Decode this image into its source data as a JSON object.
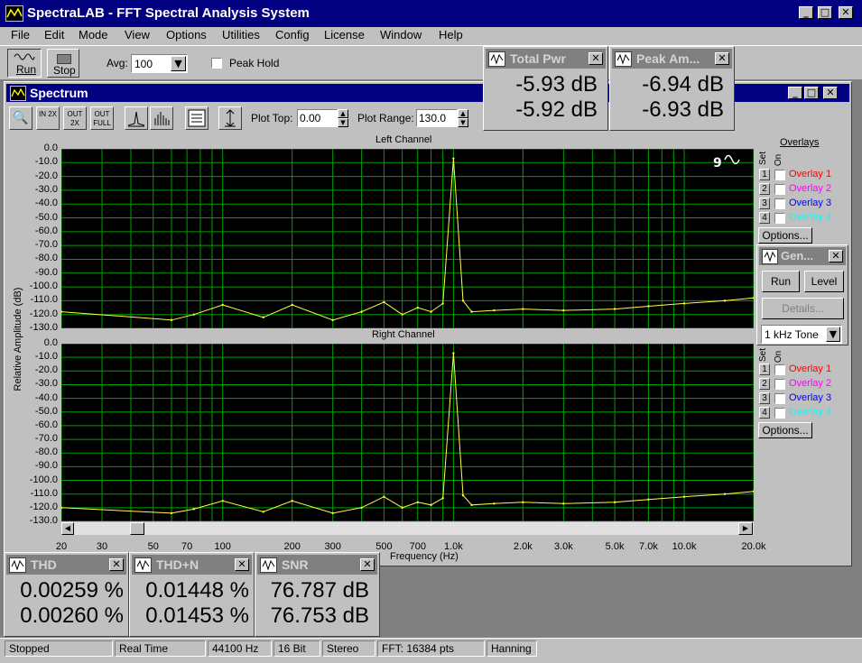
{
  "app": {
    "title": "SpectraLAB - FFT Spectral Analysis System"
  },
  "menu": [
    "File",
    "Edit",
    "Mode",
    "View",
    "Options",
    "Utilities",
    "Config",
    "License",
    "Window",
    "Help"
  ],
  "toolbar": {
    "run_label": "Run",
    "stop_label": "Stop",
    "avg_label": "Avg:",
    "avg_value": "100",
    "peak_hold_label": "Peak Hold"
  },
  "meters": {
    "total_pwr": {
      "title": "Total Pwr",
      "left": "-5.93 dB",
      "right": "-5.92 dB"
    },
    "peak_amp": {
      "title": "Peak Am...",
      "left": "-6.94 dB",
      "right": "-6.93 dB"
    },
    "thd": {
      "title": "THD",
      "left": "0.00259 %",
      "right": "0.00260 %"
    },
    "thdn": {
      "title": "THD+N",
      "left": "0.01448 %",
      "right": "0.01453 %"
    },
    "snr": {
      "title": "SNR",
      "left": "76.787 dB",
      "right": "76.753 dB"
    }
  },
  "spectrum": {
    "title": "Spectrum",
    "zoom_labels": [
      "IN 2X",
      "OUT 2X",
      "OUT FULL"
    ],
    "plot_top_label": "Plot Top:",
    "plot_top_value": "0.00",
    "plot_range_label": "Plot Range:",
    "plot_range_value": "130.0",
    "left_channel_label": "Left Channel",
    "right_channel_label": "Right Channel",
    "y_axis_label": "Relative Amplitude (dB)",
    "x_axis_label": "Frequency (Hz)",
    "y_ticks": [
      "0.0",
      "-10.0",
      "-20.0",
      "-30.0",
      "-40.0",
      "-50.0",
      "-60.0",
      "-70.0",
      "-80.0",
      "-90.0",
      "-100.0",
      "-110.0",
      "-120.0",
      "-130.0"
    ],
    "x_ticks": [
      "20",
      "30",
      "50",
      "70",
      "100",
      "200",
      "300",
      "500",
      "700",
      "1.0k",
      "2.0k",
      "3.0k",
      "5.0k",
      "7.0k",
      "10.0k",
      "20.0k"
    ]
  },
  "overlays": {
    "header": "Overlays",
    "set_label": "Set",
    "on_label": "On",
    "items": [
      {
        "num": "1",
        "label": "Overlay 1",
        "color": "#ff0000"
      },
      {
        "num": "2",
        "label": "Overlay 2",
        "color": "#ff00ff"
      },
      {
        "num": "3",
        "label": "Overlay 3",
        "color": "#0000ff"
      },
      {
        "num": "4",
        "label": "Overlay 4",
        "color": "#00ffff"
      }
    ],
    "options_label": "Options..."
  },
  "generator": {
    "title": "Gen...",
    "run_label": "Run",
    "level_label": "Level",
    "details_label": "Details...",
    "tone_value": "1 kHz Tone"
  },
  "status": [
    "Stopped",
    "Real Time",
    "44100 Hz",
    "16 Bit",
    "Stereo",
    "FFT: 16384 pts",
    "Hanning"
  ],
  "chart_data": {
    "type": "line",
    "title": "",
    "xlabel": "Frequency (Hz)",
    "ylabel": "Relative Amplitude (dB)",
    "xscale": "log",
    "xlim": [
      20,
      20000
    ],
    "ylim": [
      -130,
      0
    ],
    "grid": true,
    "series": [
      {
        "name": "Left Channel",
        "x": [
          20,
          60,
          75,
          100,
          150,
          200,
          300,
          400,
          500,
          600,
          700,
          800,
          900,
          1000,
          1100,
          1200,
          1500,
          2000,
          3000,
          5000,
          7000,
          10000,
          15000,
          20000
        ],
        "y": [
          -118,
          -124,
          -120,
          -113,
          -122,
          -113,
          -124,
          -118,
          -111,
          -120,
          -115,
          -118,
          -112,
          -7,
          -110,
          -118,
          -117,
          -116,
          -117,
          -116,
          -114,
          -112,
          -110,
          -108
        ]
      },
      {
        "name": "Right Channel",
        "x": [
          20,
          60,
          75,
          100,
          150,
          200,
          300,
          400,
          500,
          600,
          700,
          800,
          900,
          1000,
          1100,
          1200,
          1500,
          2000,
          3000,
          5000,
          7000,
          10000,
          15000,
          20000
        ],
        "y": [
          -120,
          -124,
          -121,
          -115,
          -123,
          -115,
          -124,
          -120,
          -112,
          -120,
          -116,
          -118,
          -113,
          -7,
          -111,
          -118,
          -117,
          -116,
          -117,
          -116,
          -114,
          -112,
          -110,
          -108
        ]
      }
    ],
    "colors": {
      "trace": "#ffff40",
      "plot_bg": "#000000",
      "grid": "#00a000"
    }
  }
}
